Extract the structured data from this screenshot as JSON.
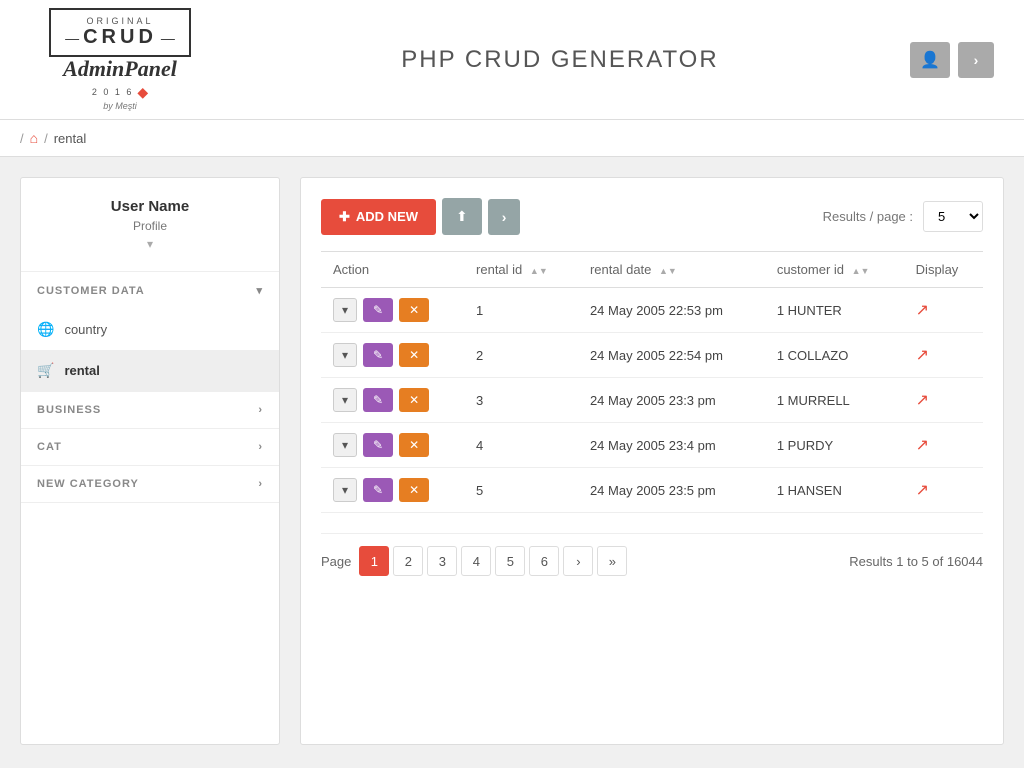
{
  "header": {
    "title": "PHP CRUD GENERATOR",
    "logo": {
      "original": "ORIGINAL",
      "crud": "CRUD",
      "admin": "Admin",
      "panel": "Panel",
      "year": "2 0 1 6",
      "by": "by Meşti"
    }
  },
  "breadcrumb": {
    "separator1": "/",
    "separator2": "/",
    "current": "rental"
  },
  "sidebar": {
    "username": "User Name",
    "profile": "Profile",
    "sections": [
      {
        "label": "CUSTOMER DATA",
        "expanded": true
      },
      {
        "label": "BUSINESS",
        "expanded": false
      },
      {
        "label": "CAT",
        "expanded": false
      },
      {
        "label": "NEW CATEGORY",
        "expanded": false
      }
    ],
    "items": [
      {
        "label": "country",
        "icon": "🌐",
        "active": false
      },
      {
        "label": "rental",
        "icon": "🛒",
        "active": true
      }
    ]
  },
  "toolbar": {
    "add_new_label": "ADD NEW",
    "results_per_page_label": "Results / page :",
    "results_per_page_value": "5"
  },
  "table": {
    "columns": [
      {
        "label": "Action"
      },
      {
        "label": "rental id"
      },
      {
        "label": "rental date"
      },
      {
        "label": "customer id"
      },
      {
        "label": "Display"
      }
    ],
    "rows": [
      {
        "id": 1,
        "rental_id": "1",
        "rental_date": "24 May 2005 22:53 pm",
        "customer_id": "1 HUNTER"
      },
      {
        "id": 2,
        "rental_id": "2",
        "rental_date": "24 May 2005 22:54 pm",
        "customer_id": "1 COLLAZO"
      },
      {
        "id": 3,
        "rental_id": "3",
        "rental_date": "24 May 2005 23:3 pm",
        "customer_id": "1 MURRELL"
      },
      {
        "id": 4,
        "rental_id": "4",
        "rental_date": "24 May 2005 23:4 pm",
        "customer_id": "1 PURDY"
      },
      {
        "id": 5,
        "rental_id": "5",
        "rental_date": "24 May 2005 23:5 pm",
        "customer_id": "1 HANSEN"
      }
    ]
  },
  "pagination": {
    "page_label": "Page",
    "pages": [
      "1",
      "2",
      "3",
      "4",
      "5",
      "6"
    ],
    "active_page": "1",
    "results_summary": "Results 1 to 5 of 16044"
  }
}
